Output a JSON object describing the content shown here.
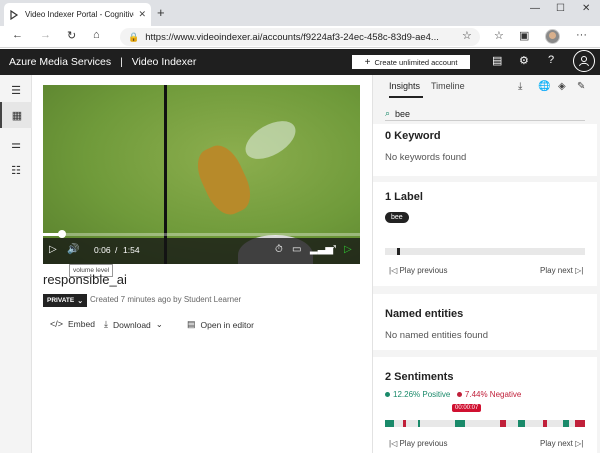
{
  "browser": {
    "tab_title": "Video Indexer Portal - Cognitive",
    "url": "https://www.videoindexer.ai/accounts/f9224af3-24ec-458c-83d9-ae4..."
  },
  "app": {
    "brand": "Azure Media Services",
    "product": "Video Indexer",
    "create_button": "Create unlimited account"
  },
  "video": {
    "current_time": "0:06",
    "separator": "/",
    "duration": "1:54",
    "progress_fraction": 0.053,
    "tooltip": "volume level",
    "title": "responsible_ai",
    "privacy": "PRIVATE",
    "created": "Created 7 minutes ago by Student Learner"
  },
  "actions": {
    "embed": "Embed",
    "download": "Download",
    "open_editor": "Open in editor"
  },
  "insights": {
    "tab_insights": "Insights",
    "tab_timeline": "Timeline",
    "search_value": "bee",
    "keywords_title": "0 Keyword",
    "keywords_msg": "No keywords found",
    "labels_title": "1 Label",
    "label_chip": "bee",
    "play_previous": "Play previous",
    "play_next": "Play next",
    "entities_title": "Named entities",
    "entities_msg": "No named entities found",
    "sentiments_title": "2 Sentiments",
    "positive": "12.26% Positive",
    "negative": "7.44% Negative",
    "time_pill": "00:00:07"
  },
  "colors": {
    "positive": "#1a8a6a",
    "negative": "#c0203a",
    "header_bg": "#1f1f1f"
  }
}
